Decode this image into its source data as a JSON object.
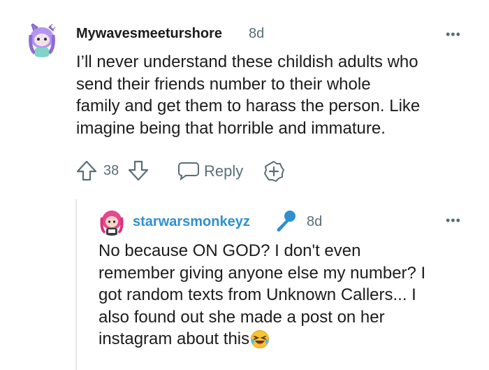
{
  "comments": [
    {
      "username": "Mywavesmeeturshore",
      "time": "8d",
      "more": "•••",
      "lines": [
        "I’ll never understand these childish adults who",
        "send their friends number to their whole",
        "family and get them to harass the person. Like",
        "imagine being that horrible and immature."
      ],
      "votes": "38",
      "reply_label": "Reply"
    },
    {
      "username": "starwarsmonkeyz",
      "time": "8d",
      "more": "•••",
      "username_color": "#2f8fd1",
      "lines": [
        "No because ON GOD? I don't even",
        "remember giving anyone else my number? I",
        "got random texts from Unknown Callers... I",
        "also found out she made a post on her",
        "instagram about this"
      ]
    }
  ],
  "icons": {
    "upvote": "arrow-up-icon",
    "downvote": "arrow-down-icon",
    "reply": "speech-bubble-icon",
    "award": "plus-award-icon",
    "mic": "microphone-icon",
    "emoji": "laughing-emoji"
  },
  "colors": {
    "muted": "#576f76",
    "text": "#1c1c1c",
    "accent_blue": "#2f8fd1"
  }
}
